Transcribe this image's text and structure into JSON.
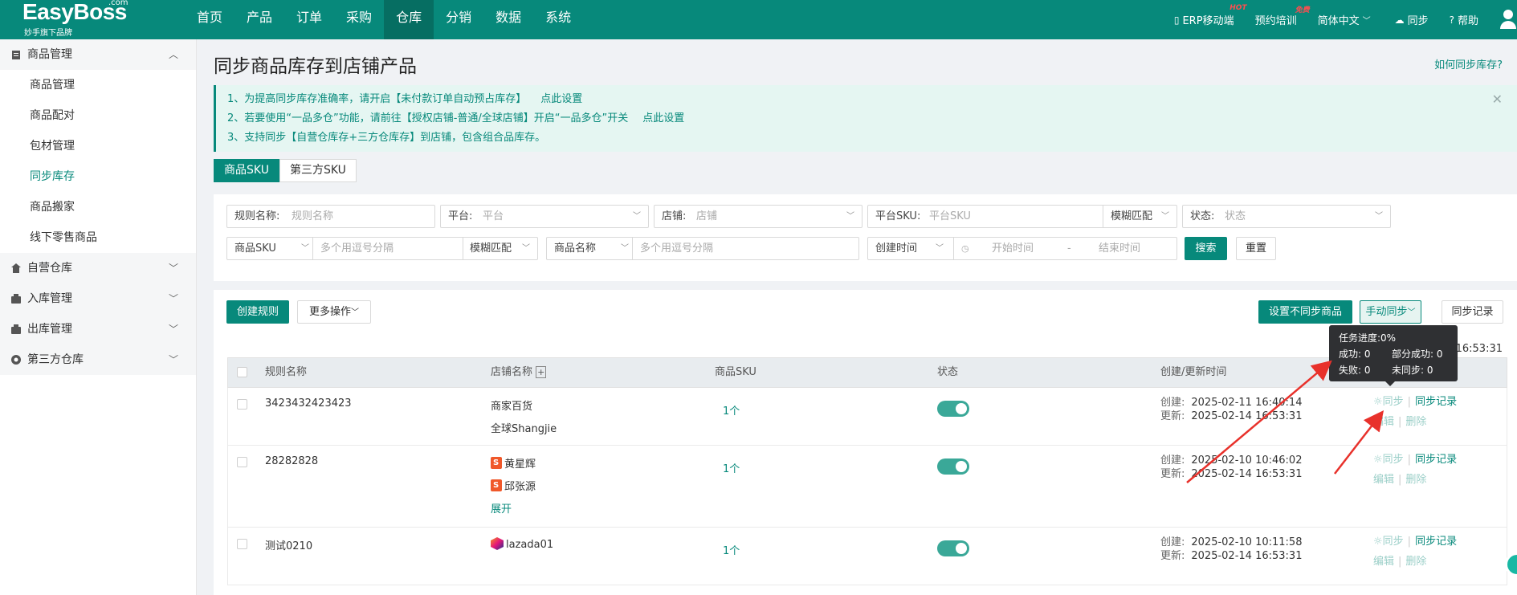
{
  "header": {
    "logo": {
      "name": "EasyBoss",
      "dotcom": ".com",
      "slogan": "妙手旗下品牌"
    },
    "nav": [
      "首页",
      "产品",
      "订单",
      "采购",
      "仓库",
      "分销",
      "数据",
      "系统"
    ],
    "active_nav": "仓库",
    "right": {
      "erp_mobile": "ERP移动端",
      "erp_badge": "HOT",
      "training": "预约培训",
      "training_badge": "免费",
      "language": "简体中文",
      "sync": "同步",
      "help": "帮助"
    }
  },
  "sidebar": {
    "groups": [
      {
        "label": "商品管理",
        "expanded": true,
        "icon": "clipboard-icon",
        "items": [
          "商品管理",
          "商品配对",
          "包材管理",
          "同步库存",
          "商品搬家",
          "线下零售商品"
        ],
        "active": "同步库存"
      },
      {
        "label": "自营仓库",
        "icon": "home-icon"
      },
      {
        "label": "入库管理",
        "icon": "inbox-icon"
      },
      {
        "label": "出库管理",
        "icon": "outbox-icon"
      },
      {
        "label": "第三方仓库",
        "icon": "warehouse-icon"
      }
    ]
  },
  "page": {
    "title": "同步商品库存到店铺产品",
    "help_link": "如何同步库存?",
    "notices": [
      {
        "text": "1、为提高同步库存准确率，请开启【未付款订单自动预占库存】",
        "link": "点此设置"
      },
      {
        "text": "2、若要使用“一品多仓”功能，请前往【授权店铺-普通/全球店铺】开启“一品多仓”开关",
        "link": "点此设置"
      },
      {
        "text": "3、支持同步【自营仓库存+三方仓库存】到店铺，包含组合品库存。",
        "link": ""
      }
    ],
    "tabs": [
      "商品SKU",
      "第三方SKU"
    ],
    "active_tab": "商品SKU"
  },
  "filters": {
    "rule_name": {
      "label": "规则名称:",
      "placeholder": "规则名称"
    },
    "platform": {
      "label": "平台:",
      "placeholder": "平台"
    },
    "shop": {
      "label": "店铺:",
      "placeholder": "店铺"
    },
    "platform_sku": {
      "label": "平台SKU:",
      "placeholder": "平台SKU",
      "match": "模糊匹配"
    },
    "status": {
      "label": "状态:",
      "placeholder": "状态"
    },
    "product_sku": {
      "label": "商品SKU",
      "placeholder": "多个用逗号分隔",
      "match": "模糊匹配"
    },
    "product_name": {
      "label": "商品名称",
      "placeholder": "多个用逗号分隔"
    },
    "created_time": {
      "label": "创建时间",
      "start": "开始时间",
      "dash": "-",
      "end": "结束时间"
    },
    "search": "搜索",
    "reset": "重置"
  },
  "toolbar": {
    "create_rule": "创建规则",
    "more_ops": "更多操作",
    "set_not_sync": "设置不同步商品",
    "manual_sync": "手动同步",
    "sync_log": "同步记录",
    "sync_time": "16:53:31"
  },
  "table": {
    "columns": [
      "规则名称",
      "店铺名称",
      "商品SKU",
      "状态",
      "创建/更新时间"
    ],
    "created_label": "创建:",
    "updated_label": "更新:",
    "rows": [
      {
        "rule": "3423432423423",
        "shops": [
          "商家百货",
          "全球Shangjie"
        ],
        "shop_icon": "none",
        "sku": "1个",
        "enabled": true,
        "created": "2025-02-11 16:40:14",
        "updated": "2025-02-14 16:53:31"
      },
      {
        "rule": "28282828",
        "shops": [
          "黄星辉",
          "邱张源"
        ],
        "shop_icon": "shopee-icon",
        "expand": "展开",
        "sku": "1个",
        "enabled": true,
        "created": "2025-02-10 10:46:02",
        "updated": "2025-02-14 16:53:31"
      },
      {
        "rule": "测试0210",
        "shops": [
          "lazada01"
        ],
        "shop_icon": "lazada-icon",
        "sku": "1个",
        "enabled": true,
        "created": "2025-02-10 10:11:58",
        "updated": "2025-02-14 16:53:31"
      }
    ],
    "actions": {
      "sync": "同步",
      "log": "同步记录",
      "edit": "编辑",
      "delete": "删除"
    }
  },
  "tooltip": {
    "progress_label": "任务进度:",
    "progress": "0%",
    "success_label": "成功:",
    "success": "0",
    "partial_label": "部分成功:",
    "partial": "0",
    "fail_label": "失败:",
    "fail": "0",
    "unsynced_label": "未同步:",
    "unsynced": "0"
  },
  "colors": {
    "brand": "#07897b",
    "notice_bg": "#e5f6f2",
    "arrow": "#e8312b"
  }
}
